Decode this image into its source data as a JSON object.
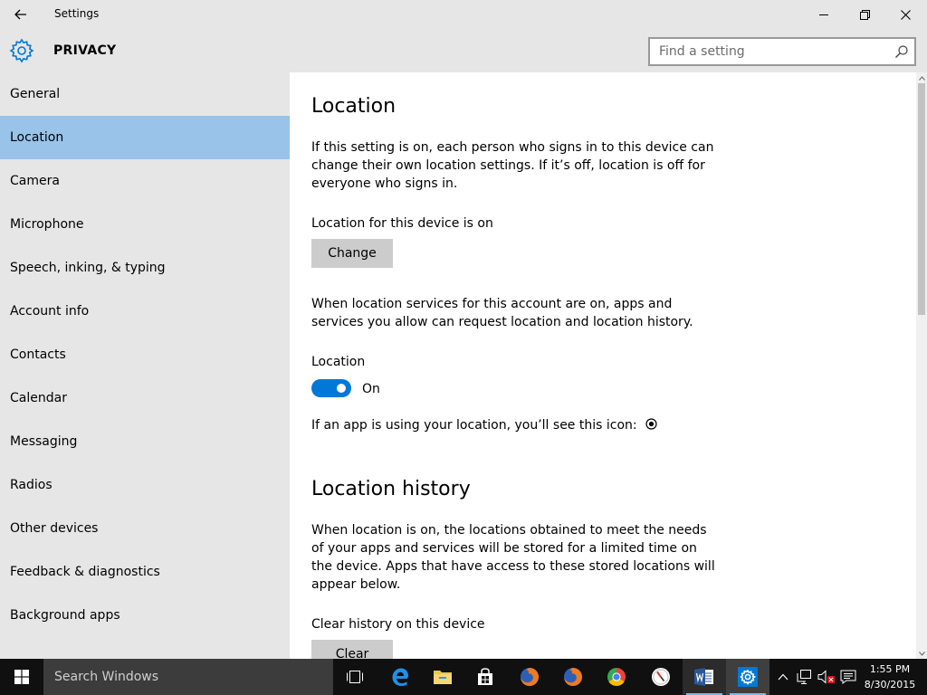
{
  "window": {
    "title": "Settings",
    "section": "PRIVACY"
  },
  "search": {
    "placeholder": "Find a setting"
  },
  "sidebar": {
    "items": [
      {
        "label": "General"
      },
      {
        "label": "Location",
        "active": true
      },
      {
        "label": "Camera"
      },
      {
        "label": "Microphone"
      },
      {
        "label": "Speech, inking, & typing"
      },
      {
        "label": "Account info"
      },
      {
        "label": "Contacts"
      },
      {
        "label": "Calendar"
      },
      {
        "label": "Messaging"
      },
      {
        "label": "Radios"
      },
      {
        "label": "Other devices"
      },
      {
        "label": "Feedback & diagnostics"
      },
      {
        "label": "Background apps"
      }
    ]
  },
  "main": {
    "location": {
      "heading": "Location",
      "description": "If this setting is on, each person who signs in to this device can change their own location settings. If it’s off, location is off for everyone who signs in.",
      "device_status": "Location for this device is on",
      "change_button": "Change",
      "account_description": "When location services for this account are on, apps and services you allow can request location and location history.",
      "toggle_label": "Location",
      "toggle_state": "On",
      "toggle_on": true,
      "icon_note": "If an app is using your location, you’ll see this icon:"
    },
    "history": {
      "heading": "Location history",
      "description": "When location is on, the locations obtained to meet the needs of your apps and services will be stored for a limited time on the device. Apps that have access to these stored locations will appear below.",
      "clear_label": "Clear history on this device",
      "clear_button": "Clear"
    }
  },
  "taskbar": {
    "search_text": "Search Windows",
    "time": "1:55 PM",
    "date": "8/30/2015"
  },
  "colors": {
    "accent": "#0078d7",
    "sidebar_selected": "#99c3e8",
    "chrome": "#e6e6e6",
    "taskbar": "#101010"
  }
}
